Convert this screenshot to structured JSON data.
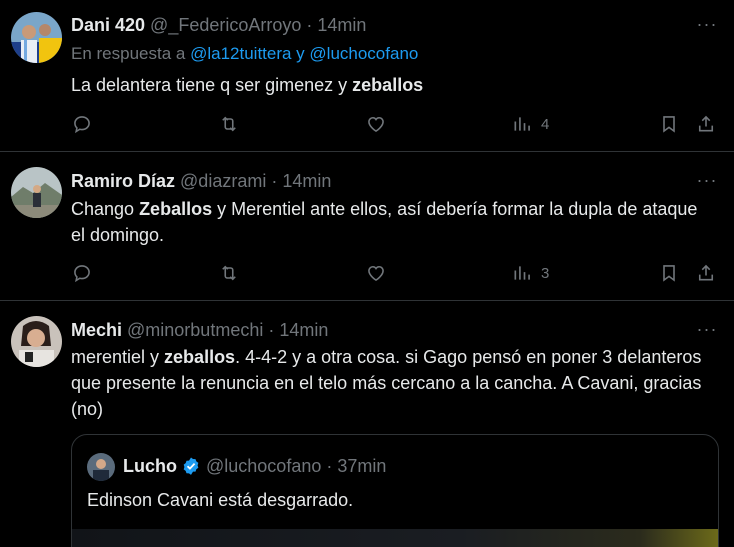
{
  "tweets": [
    {
      "name": "Dani 420",
      "handle": "@_FedericoArroyo",
      "dot": "·",
      "time": "14min",
      "reply_prefix": "En respuesta a",
      "reply_mentions": "@la12tuittera y @luchocofano",
      "text_plain": "La delantera tiene q ser gimenez y ",
      "text_bold": "zeballos",
      "views": "4",
      "avatar_icon": "profile-photo"
    },
    {
      "name": "Ramiro Díaz",
      "handle": "@diazrami",
      "dot": "·",
      "time": "14min",
      "text_plain_1": "Chango ",
      "text_bold": "Zeballos",
      "text_plain_2": " y Merentiel ante ellos, así debería formar la dupla de ataque el domingo.",
      "views": "3",
      "avatar_icon": "profile-photo"
    },
    {
      "name": "Mechi",
      "handle": "@minorbutmechi",
      "dot": "·",
      "time": "14min",
      "text_plain_1": "merentiel y ",
      "text_bold": "zeballos",
      "text_plain_2": ". 4-4-2 y a otra cosa. si Gago pensó en poner 3 delanteros que presente la renuncia en el telo más cercano a la cancha. A Cavani, gracias (no)",
      "avatar_icon": "profile-photo",
      "quote": {
        "name": "Lucho",
        "handle": "@luchocofano",
        "dot": "·",
        "time": "37min",
        "text": "Edinson Cavani está desgarrado.",
        "verified_icon": "verified-badge-icon"
      }
    }
  ],
  "more_label": "···",
  "icons": [
    "reply-icon",
    "retweet-icon",
    "like-icon",
    "views-icon",
    "bookmark-icon",
    "share-icon"
  ],
  "colors": {
    "background": "#000000",
    "text": "#e7e9ea",
    "muted": "#71767b",
    "link": "#1d9bf0",
    "divider": "#2f3336"
  }
}
